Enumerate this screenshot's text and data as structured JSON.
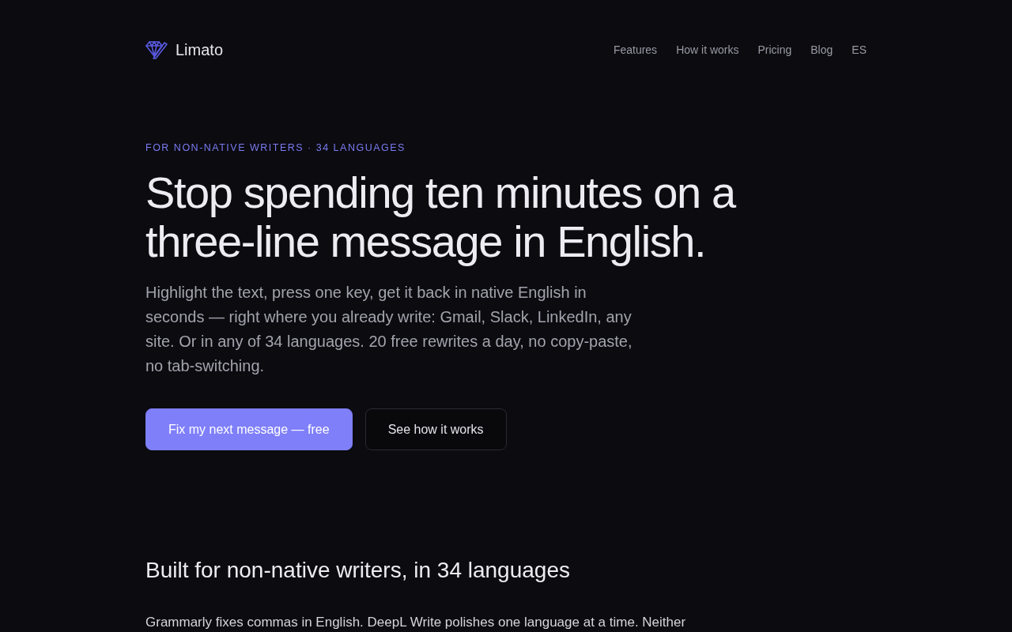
{
  "header": {
    "brand": "Limato",
    "nav": [
      {
        "label": "Features"
      },
      {
        "label": "How it works"
      },
      {
        "label": "Pricing"
      },
      {
        "label": "Blog"
      },
      {
        "label": "ES"
      }
    ]
  },
  "hero": {
    "eyebrow": "FOR NON-NATIVE WRITERS · 34 LANGUAGES",
    "title": "Stop spending ten minutes on a three-line message in English.",
    "lead": "Highlight the text, press one key, get it back in native English in seconds — right where you already write: Gmail, Slack, LinkedIn, any site. Or in any of 34 languages. 20 free rewrites a day, no copy-paste, no tab-switching.",
    "buttons": [
      {
        "label": "Fix my next message — free",
        "kind": "primary"
      },
      {
        "label": "See how it works",
        "kind": "secondary"
      }
    ]
  },
  "section": {
    "heading": "Built for non-native writers, in 34 languages",
    "body": "Grammarly fixes commas in English. DeepL Write polishes one language at a time. Neither"
  }
}
